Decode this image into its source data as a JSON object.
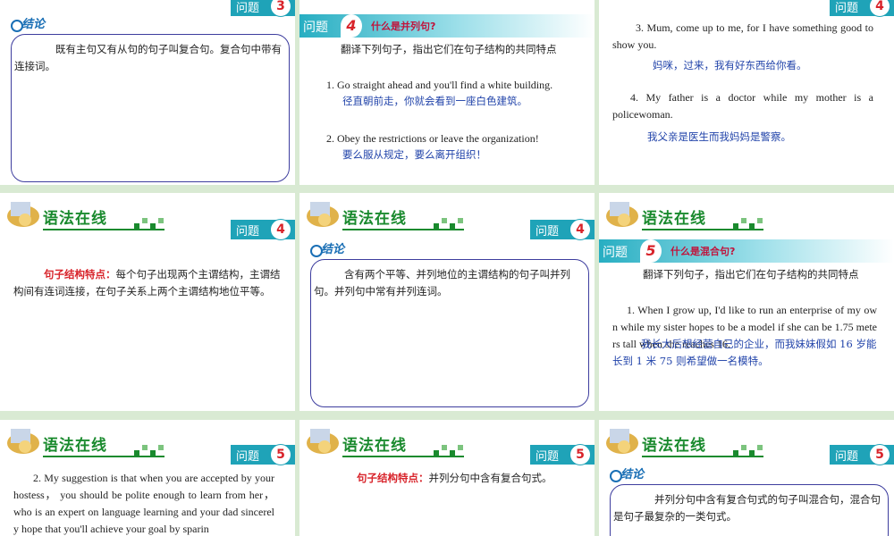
{
  "header": {
    "title": "语法在线",
    "badge_label": "问题"
  },
  "slides": {
    "s1": {
      "badge_num": "3",
      "conc_label": "结论",
      "text": "既有主句又有从句的句子叫复合句。复合句中带有连接词。"
    },
    "s2": {
      "q_label": "问题",
      "q_num": "4",
      "q_title": "什么是并列句?",
      "intro": "翻译下列句子，指出它们在句子结构的共同特点",
      "item1_en": "1. Go straight ahead and you'll find a white building.",
      "item1_cn": "径直朝前走，你就会看到一座白色建筑。",
      "item2_en": "2. Obey the restrictions or leave the organization!",
      "item2_cn": "要么服从规定，要么离开组织！"
    },
    "s3": {
      "badge_num": "4",
      "item3_en": "3. Mum, come up to me, for I have something good to show you.",
      "item3_cn": "妈咪，过来，我有好东西给你看。",
      "item4_en": "4. My father is a doctor while my mother is a policewoman.",
      "item4_cn": "我父亲是医生而我妈妈是警察。"
    },
    "s4": {
      "badge_num": "4",
      "label": "句子结构特点：",
      "text": "每个句子出现两个主谓结构，主谓结构间有连词连接，在句子关系上两个主谓结构地位平等。"
    },
    "s5": {
      "badge_num": "4",
      "conc_label": "结论",
      "text": "含有两个平等、并列地位的主谓结构的句子叫并列句。并列句中常有并列连词。"
    },
    "s6": {
      "q_label": "问题",
      "q_num": "5",
      "q_title": "什么是混合句?",
      "intro": "翻译下列句子，指出它们在句子结构的共同特点",
      "item1_en": "1. When I grow up, I'd like to run an enterprise of my own while my sister hopes to be a model if she can be 1.75 meters tall when she reaches 16.",
      "item1_cn": "我长大后想经营自己的企业，而我妹妹假如 16 岁能长到 1 米 75 则希望做一名模特。"
    },
    "s7": {
      "badge_num": "5",
      "text": "2. My suggestion is that when you are accepted by your hostess， you should be polite enough to learn from her， who is an expert on language learning and your dad sincerely hope that you'll achieve your goal by sparin"
    },
    "s8": {
      "badge_num": "5",
      "label": "句子结构特点：",
      "text": "并列分句中含有复合句式。"
    },
    "s9": {
      "badge_num": "5",
      "conc_label": "结论",
      "text": "并列分句中含有复合句式的句子叫混合句，混合句是句子最复杂的一类句式。"
    }
  },
  "colors": {
    "green": "#1a8a2e",
    "teal": "#1fa3b8",
    "red": "#d8232a",
    "blue_cn": "#2244aa",
    "box": "#3d3d9e"
  }
}
